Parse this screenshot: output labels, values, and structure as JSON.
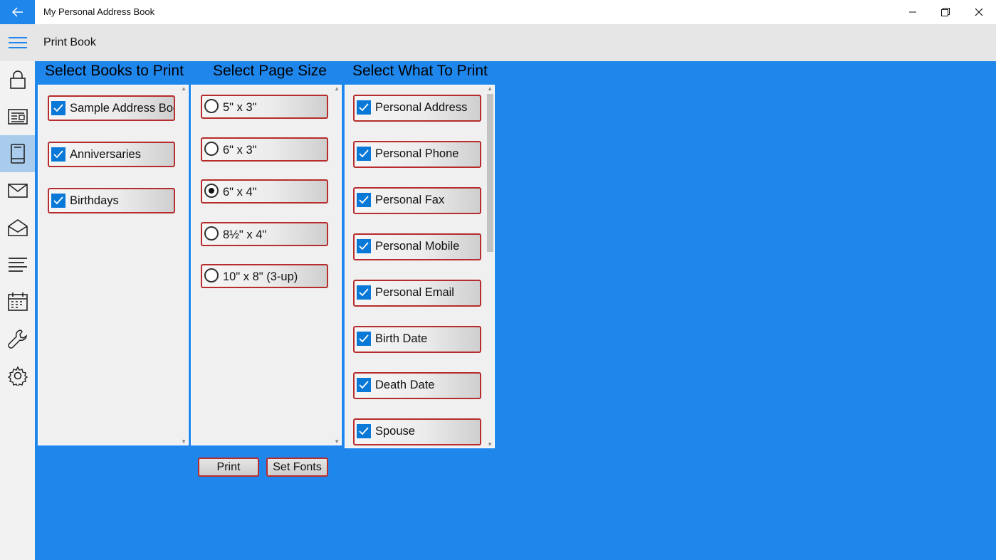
{
  "window": {
    "title": "My Personal Address Book"
  },
  "header": {
    "title": "Print Book"
  },
  "sidebar": {
    "items": [
      "lock-icon",
      "news-icon",
      "book-icon",
      "mail-icon",
      "mail-open-icon",
      "list-icon",
      "calendar-icon",
      "wrench-icon",
      "gear-icon"
    ],
    "active_index": 2
  },
  "books": {
    "title": "Select Books to Print",
    "items": [
      {
        "label": "Sample Address Book",
        "checked": true
      },
      {
        "label": "Anniversaries",
        "checked": true
      },
      {
        "label": "Birthdays",
        "checked": true
      }
    ]
  },
  "page_size": {
    "title": "Select Page Size",
    "options": [
      {
        "label": "5\" x 3\"",
        "selected": false
      },
      {
        "label": "6\" x 3\"",
        "selected": false
      },
      {
        "label": "6\" x 4\"",
        "selected": true
      },
      {
        "label": "8½\" x 4\"",
        "selected": false
      },
      {
        "label": "10\" x 8\" (3-up)",
        "selected": false
      }
    ]
  },
  "what_to_print": {
    "title": "Select What To Print",
    "items": [
      {
        "label": "Personal Address",
        "checked": true
      },
      {
        "label": "Personal Phone",
        "checked": true
      },
      {
        "label": "Personal Fax",
        "checked": true
      },
      {
        "label": "Personal Mobile",
        "checked": true
      },
      {
        "label": "Personal Email",
        "checked": true
      },
      {
        "label": "Birth Date",
        "checked": true
      },
      {
        "label": "Death Date",
        "checked": true
      },
      {
        "label": "Spouse",
        "checked": true
      }
    ]
  },
  "buttons": {
    "print": "Print",
    "set_fonts": "Set Fonts"
  },
  "colors": {
    "accent": "#1f86ec",
    "border": "#b72c2c",
    "checkbox": "#0a78d7"
  }
}
